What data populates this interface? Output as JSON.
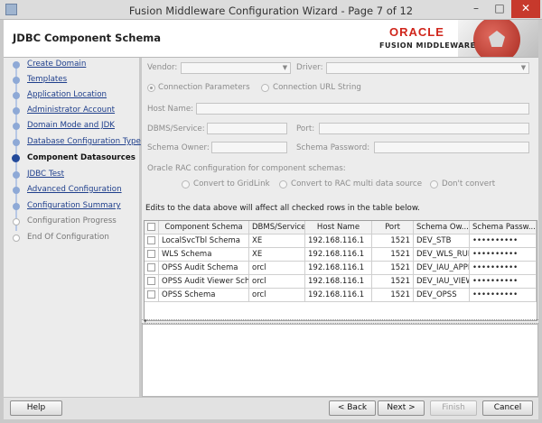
{
  "window": {
    "title": "Fusion Middleware Configuration Wizard - Page 7 of 12"
  },
  "header": {
    "page_title": "JDBC Component Schema",
    "brand": "ORACLE",
    "subbrand": "FUSION MIDDLEWARE"
  },
  "nav": {
    "items": [
      {
        "label": "Create Domain",
        "state": "done"
      },
      {
        "label": "Templates",
        "state": "done"
      },
      {
        "label": "Application Location",
        "state": "done"
      },
      {
        "label": "Administrator Account",
        "state": "done"
      },
      {
        "label": "Domain Mode and JDK",
        "state": "done"
      },
      {
        "label": "Database Configuration Type",
        "state": "done"
      },
      {
        "label": "Component Datasources",
        "state": "current"
      },
      {
        "label": "JDBC Test",
        "state": "done"
      },
      {
        "label": "Advanced Configuration",
        "state": "done"
      },
      {
        "label": "Configuration Summary",
        "state": "done"
      },
      {
        "label": "Configuration Progress",
        "state": "pending"
      },
      {
        "label": "End Of Configuration",
        "state": "pending"
      }
    ]
  },
  "form": {
    "vendor_label": "Vendor:",
    "driver_label": "Driver:",
    "conn_params_label": "Connection Parameters",
    "conn_url_label": "Connection URL String",
    "host_name_label": "Host Name:",
    "dbms_service_label": "DBMS/Service:",
    "port_label": "Port:",
    "schema_owner_label": "Schema Owner:",
    "schema_password_label": "Schema Password:",
    "rac_label": "Oracle RAC configuration for component schemas:",
    "rac_gridlink": "Convert to GridLink",
    "rac_multi": "Convert to RAC multi data source",
    "rac_dont": "Don't convert",
    "edits_note": "Edits to the data above will affect all checked rows in the table below."
  },
  "table": {
    "headers": [
      "Component Schema",
      "DBMS/Service",
      "Host Name",
      "Port",
      "Schema Ow...",
      "Schema Passw..."
    ],
    "rows": [
      [
        "LocalSvcTbl Schema",
        "XE",
        "192.168.116.1",
        "1521",
        "DEV_STB",
        "••••••••••"
      ],
      [
        "WLS Schema",
        "XE",
        "192.168.116.1",
        "1521",
        "DEV_WLS_RUN",
        "••••••••••"
      ],
      [
        "OPSS Audit Schema",
        "orcl",
        "192.168.116.1",
        "1521",
        "DEV_IAU_APPE",
        "••••••••••"
      ],
      [
        "OPSS Audit Viewer Sch",
        "orcl",
        "192.168.116.1",
        "1521",
        "DEV_IAU_VIEW",
        "••••••••••"
      ],
      [
        "OPSS Schema",
        "orcl",
        "192.168.116.1",
        "1521",
        "DEV_OPSS",
        "••••••••••"
      ]
    ]
  },
  "footer": {
    "help": "Help",
    "back": "< Back",
    "next": "Next >",
    "finish": "Finish",
    "cancel": "Cancel"
  }
}
